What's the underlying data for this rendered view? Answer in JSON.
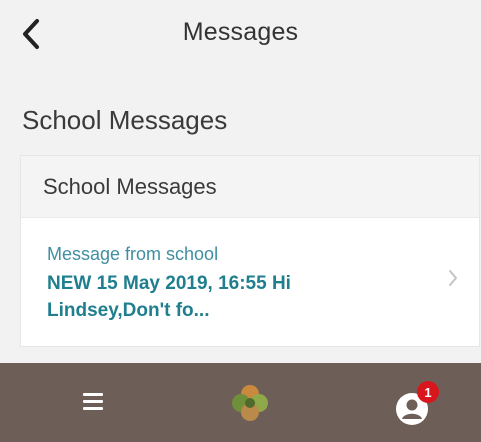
{
  "header": {
    "title": "Messages",
    "back_icon": "chevron-left-icon"
  },
  "section": {
    "title": "School Messages"
  },
  "card": {
    "header": "School Messages",
    "items": [
      {
        "label": "Message from school",
        "body": "NEW 15 May 2019, 16:55 Hi Lindsey,Don't fo...",
        "chevron_icon": "chevron-right-icon"
      }
    ]
  },
  "bottom_bar": {
    "menu_icon": "hamburger-menu-icon",
    "logo_icon": "school-logo-icon",
    "profile_icon": "user-profile-icon",
    "notification_count": "1"
  },
  "colors": {
    "background": "#f2f2f2",
    "bottom_bar": "#6d5f57",
    "accent_text": "#1f7f8f",
    "label_text": "#3f8fa0",
    "badge": "#d9151e"
  }
}
